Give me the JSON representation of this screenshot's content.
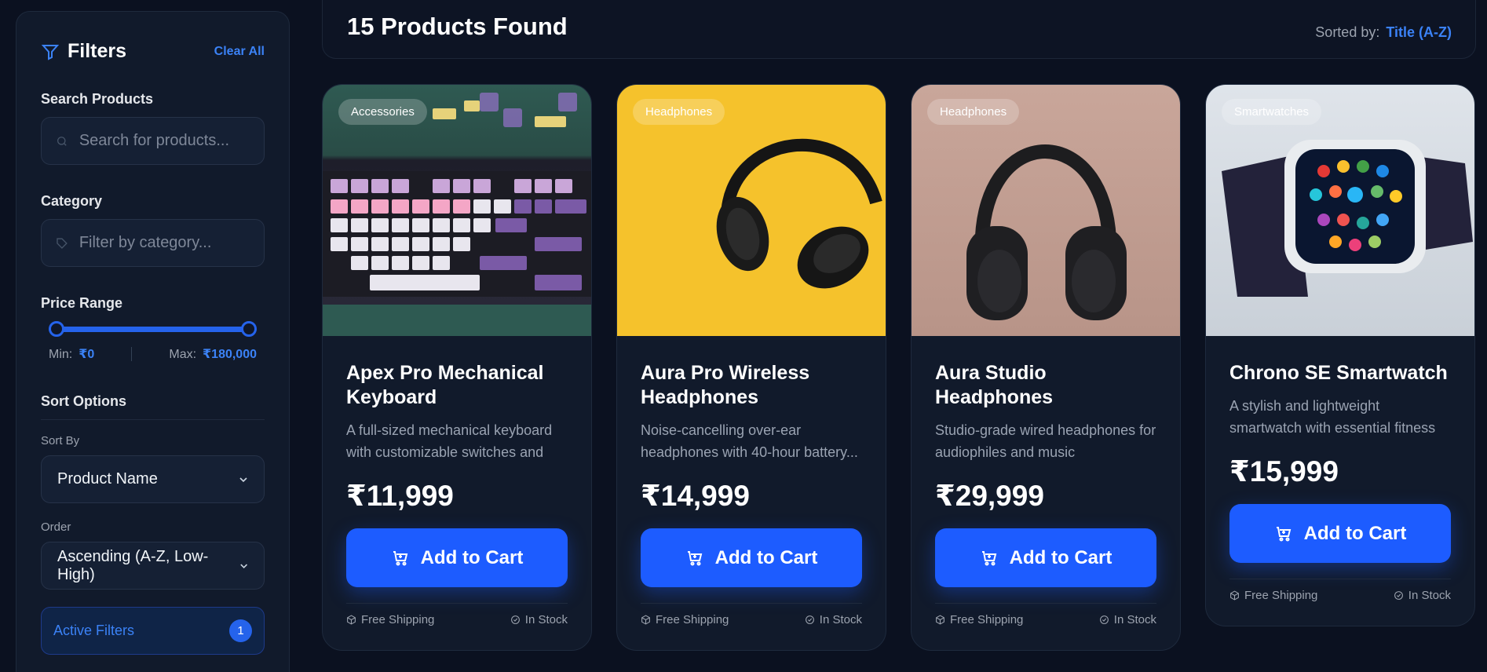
{
  "sidebar": {
    "title": "Filters",
    "clear_all": "Clear All",
    "search_label": "Search Products",
    "search_placeholder": "Search for products...",
    "category_label": "Category",
    "category_placeholder": "Filter by category...",
    "price_label": "Price Range",
    "price_range_fill": {
      "min_fraction": 0,
      "max_fraction": 1
    },
    "min_label": "Min:",
    "min_value": "₹0",
    "max_label": "Max:",
    "max_value": "₹180,000",
    "sort_options_label": "Sort Options",
    "sort_by_label": "Sort By",
    "sort_by_value": "Product Name",
    "order_label": "Order",
    "order_value": "Ascending (A-Z, Low-High)",
    "active_filters_label": "Active Filters",
    "active_filters_count": "1"
  },
  "header": {
    "title": "15 Products Found",
    "sorted_label": "Sorted by:",
    "sorted_value": "Title (A-Z)"
  },
  "colors": {
    "accent": "#1d5cff",
    "link": "#3b82f6",
    "background": "#0b1120",
    "card": "#111a2b"
  },
  "products": [
    {
      "category": "Accessories",
      "name": "Apex Pro Mechanical Keyboard",
      "description": "A full-sized mechanical keyboard with customizable switches and pe...",
      "price": "₹11,999",
      "button": "Add to Cart",
      "shipping": "Free Shipping",
      "stock": "In Stock"
    },
    {
      "category": "Headphones",
      "name": "Aura Pro Wireless Headphones",
      "description": "Noise-cancelling over-ear headphones with 40-hour battery...",
      "price": "₹14,999",
      "button": "Add to Cart",
      "shipping": "Free Shipping",
      "stock": "In Stock"
    },
    {
      "category": "Headphones",
      "name": "Aura Studio Headphones",
      "description": "Studio-grade wired headphones for audiophiles and music producers....",
      "price": "₹29,999",
      "button": "Add to Cart",
      "shipping": "Free Shipping",
      "stock": "In Stock"
    },
    {
      "category": "Smartwatches",
      "name": "Chrono SE Smartwatch",
      "description": "A stylish and lightweight smartwatch with essential fitness tracking and ...",
      "price": "₹15,999",
      "button": "Add to Cart",
      "shipping": "Free Shipping",
      "stock": "In Stock"
    }
  ]
}
